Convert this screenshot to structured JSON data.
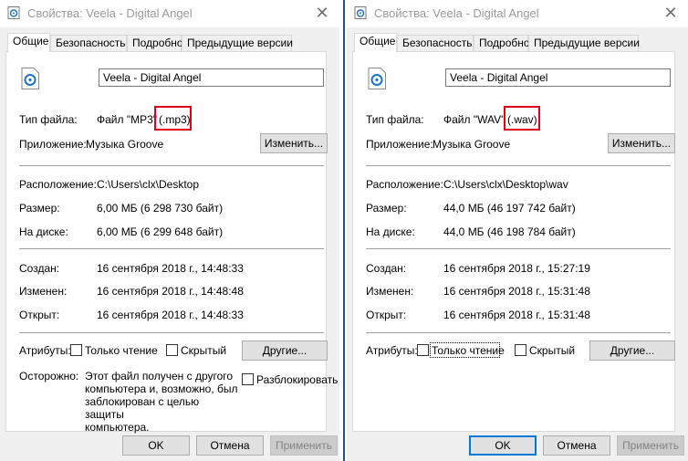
{
  "left": {
    "title": "Свойства: Veela - Digital Angel",
    "tabs": [
      "Общие",
      "Безопасность",
      "Подробно",
      "Предыдущие версии"
    ],
    "filename": "Veela - Digital Angel",
    "type_label": "Тип файла:",
    "type_value": "Файл \"MP3\"",
    "type_ext": "(.mp3)",
    "app_label": "Приложение:",
    "app_value": "Музыка Groove",
    "change_button": "Изменить...",
    "location_label": "Расположение:",
    "location_value": "C:\\Users\\clx\\Desktop",
    "size_label": "Размер:",
    "size_value": "6,00 МБ (6 298 730 байт)",
    "disk_label": "На диске:",
    "disk_value": "6,00 МБ (6 299 648 байт)",
    "created_label": "Создан:",
    "created_value": "16 сентября 2018 г., 14:48:33",
    "modified_label": "Изменен:",
    "modified_value": "16 сентября 2018 г., 14:48:48",
    "opened_label": "Открыт:",
    "opened_value": "16 сентября 2018 г., 14:48:33",
    "attributes_label": "Атрибуты:",
    "readonly_label": "Только чтение",
    "hidden_label": "Скрытый",
    "other_button": "Другие...",
    "security_label": "Осторожно:",
    "security_text": [
      "Этот файл получен с другого",
      "компьютера и, возможно, был",
      "заблокирован с целью защиты",
      "компьютера."
    ],
    "unblock_label": "Разблокировать",
    "ok_button": "OK",
    "cancel_button": "Отмена",
    "apply_button": "Применить"
  },
  "right": {
    "title": "Свойства: Veela - Digital Angel",
    "tabs": [
      "Общие",
      "Безопасность",
      "Подробно",
      "Предыдущие версии"
    ],
    "filename": "Veela - Digital Angel",
    "type_label": "Тип файла:",
    "type_value": "Файл \"WAV\"",
    "type_ext": "(.wav)",
    "app_label": "Приложение:",
    "app_value": "Музыка Groove",
    "change_button": "Изменить...",
    "location_label": "Расположение:",
    "location_value": "C:\\Users\\clx\\Desktop\\wav",
    "size_label": "Размер:",
    "size_value": "44,0 МБ (46 197 742 байт)",
    "disk_label": "На диске:",
    "disk_value": "44,0 МБ (46 198 784 байт)",
    "created_label": "Создан:",
    "created_value": "16 сентября 2018 г., 15:27:19",
    "modified_label": "Изменен:",
    "modified_value": "16 сентября 2018 г., 15:31:48",
    "opened_label": "Открыт:",
    "opened_value": "16 сентября 2018 г., 15:31:48",
    "attributes_label": "Атрибуты:",
    "readonly_label": "Только чтение",
    "hidden_label": "Скрытый",
    "other_button": "Другие...",
    "ok_button": "OK",
    "cancel_button": "Отмена",
    "apply_button": "Применить"
  },
  "colors": {
    "highlight": "#e0001b",
    "accent": "#0078d7",
    "divider": "#2b4b8a"
  },
  "icons": {
    "file": "music-file-icon",
    "close": "close-icon"
  }
}
